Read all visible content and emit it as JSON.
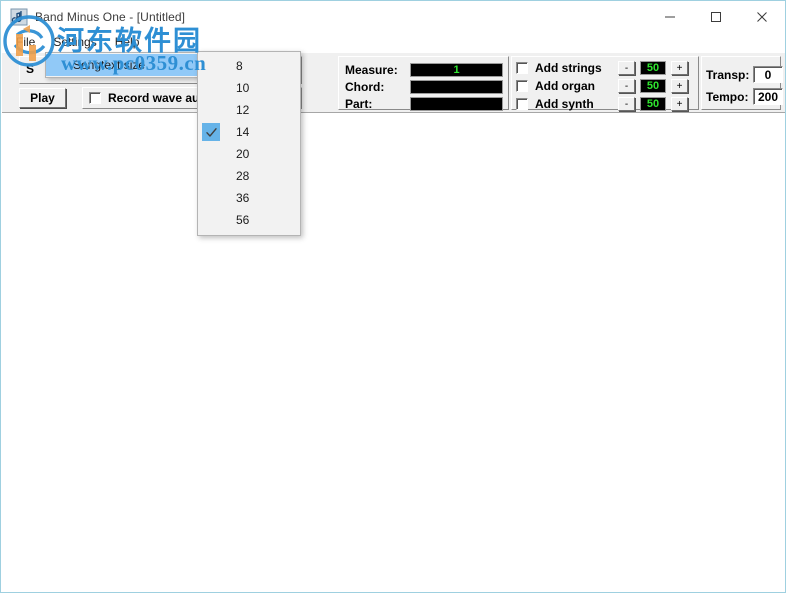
{
  "window": {
    "title": "Band Minus One - [Untitled]",
    "icon": "music-note-icon",
    "buttons": {
      "minimize": "minimize-icon",
      "maximize": "maximize-icon",
      "close": "close-icon"
    }
  },
  "menu_bar": {
    "items": [
      {
        "label": "File"
      },
      {
        "label": "Settings"
      },
      {
        "label": "Help"
      }
    ]
  },
  "settings_menu": {
    "items": [
      {
        "label": "Songtext size",
        "has_submenu": true,
        "arrow": "›",
        "selected": true
      }
    ]
  },
  "size_submenu": {
    "items": [
      {
        "label": "8",
        "checked": false
      },
      {
        "label": "10",
        "checked": false
      },
      {
        "label": "12",
        "checked": false
      },
      {
        "label": "14",
        "checked": true
      },
      {
        "label": "20",
        "checked": false
      },
      {
        "label": "28",
        "checked": false
      },
      {
        "label": "36",
        "checked": false
      },
      {
        "label": "56",
        "checked": false
      }
    ],
    "check_glyph": "check-icon"
  },
  "toolbar": {
    "song_label": "S",
    "play_label": "Play",
    "record_checkbox": {
      "label": "Record wave au",
      "checked": false
    },
    "status_square": "status-indicator",
    "info_rows": [
      {
        "label": "Measure:",
        "value": "1"
      },
      {
        "label": "Chord:",
        "value": ""
      },
      {
        "label": "Part:",
        "value": ""
      }
    ],
    "instruments": [
      {
        "label": "Add strings",
        "checked": false,
        "minus": "-",
        "value": "50",
        "plus": "+"
      },
      {
        "label": "Add organ",
        "checked": false,
        "minus": "-",
        "value": "50",
        "plus": "+"
      },
      {
        "label": "Add synth",
        "checked": false,
        "minus": "-",
        "value": "50",
        "plus": "+"
      }
    ],
    "transpose": {
      "label": "Transp:",
      "value": "0"
    },
    "tempo": {
      "label": "Tempo:",
      "value": "200"
    }
  },
  "watermark": {
    "chinese": "河东软件园",
    "url": "www.pc0359.cn",
    "color": "#2e8fd4"
  },
  "colors": {
    "lcd_text": "#2fe52f",
    "lcd_bg": "#000000",
    "menu_highlight": "#91c9f7",
    "check_highlight": "#66b3e8",
    "toolbar_bg": "#f0f0f0"
  }
}
